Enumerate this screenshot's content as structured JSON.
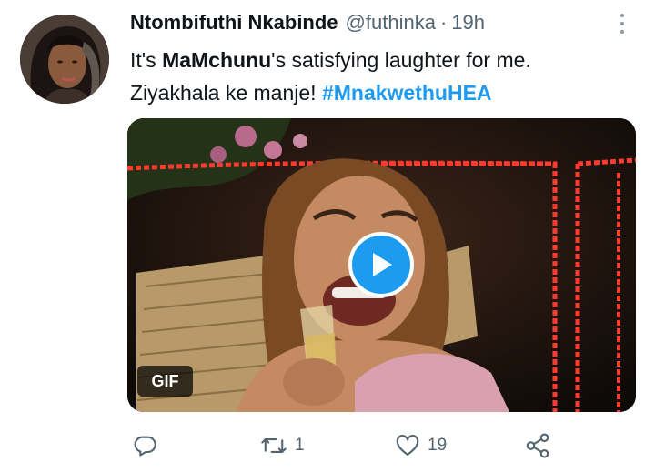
{
  "tweet": {
    "author_name": "Ntombifuthi Nkabinde",
    "handle": "@futhinka",
    "separator": "·",
    "time": "19h",
    "text_part1": "It's ",
    "mention_bold": "MaMchunu",
    "text_part2": "'s satisfying laughter for me.",
    "text_line2": "Ziyakhala ke manje! ",
    "hashtag": "#MnakwethuHEA"
  },
  "media": {
    "badge": "GIF",
    "play_color": "#1d9bf0"
  },
  "actions": {
    "reply_icon": "reply-icon",
    "retweet_icon": "retweet-icon",
    "retweet_count": "1",
    "like_icon": "heart-icon",
    "like_count": "19",
    "share_icon": "share-icon"
  },
  "colors": {
    "accent": "#1d9bf0",
    "muted": "#536471"
  }
}
